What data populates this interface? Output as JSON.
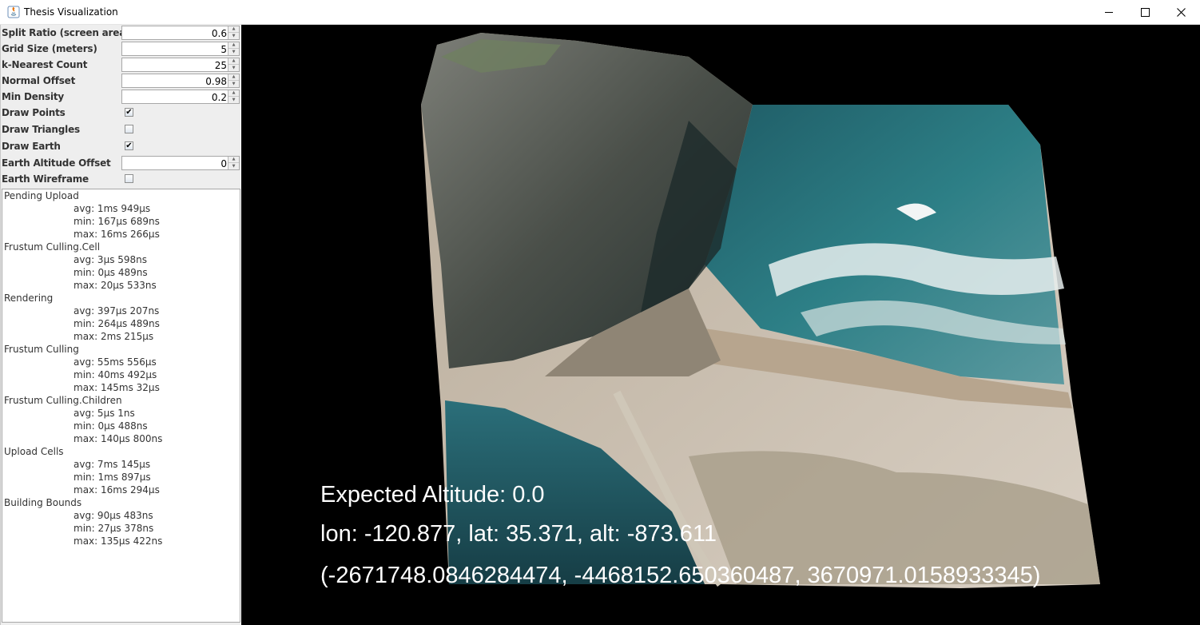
{
  "window": {
    "title": "Thesis Visualization"
  },
  "settings": [
    {
      "label": "Split Ratio (screen area)",
      "type": "spinner",
      "value": "0.6"
    },
    {
      "label": "Grid Size (meters)",
      "type": "spinner",
      "value": "5"
    },
    {
      "label": "k-Nearest Count",
      "type": "spinner",
      "value": "25"
    },
    {
      "label": "Normal Offset",
      "type": "spinner",
      "value": "0.98"
    },
    {
      "label": "Min Density",
      "type": "spinner",
      "value": "0.2"
    },
    {
      "label": "Draw Points",
      "type": "checkbox",
      "checked": true
    },
    {
      "label": "Draw Triangles",
      "type": "checkbox",
      "checked": false
    },
    {
      "label": "Draw Earth",
      "type": "checkbox",
      "checked": true
    },
    {
      "label": "Earth Altitude Offset",
      "type": "spinner",
      "value": "0"
    },
    {
      "label": "Earth Wireframe",
      "type": "checkbox",
      "checked": false
    }
  ],
  "stats": [
    {
      "name": "Pending Upload",
      "avg": "avg: 1ms 949µs",
      "min": "min: 167µs 689ns",
      "max": "max: 16ms 266µs"
    },
    {
      "name": "Frustum Culling.Cell",
      "avg": "avg: 3µs 598ns",
      "min": "min: 0µs 489ns",
      "max": "max: 20µs 533ns"
    },
    {
      "name": "Rendering",
      "avg": "avg: 397µs 207ns",
      "min": "min: 264µs 489ns",
      "max": "max: 2ms 215µs"
    },
    {
      "name": "Frustum Culling",
      "avg": "avg: 55ms 556µs",
      "min": "min: 40ms 492µs",
      "max": "max: 145ms 32µs"
    },
    {
      "name": "Frustum Culling.Children",
      "avg": "avg: 5µs 1ns",
      "min": "min: 0µs 488ns",
      "max": "max: 140µs 800ns"
    },
    {
      "name": "Upload Cells",
      "avg": "avg: 7ms 145µs",
      "min": "min: 1ms 897µs",
      "max": "max: 16ms 294µs"
    },
    {
      "name": "Building Bounds",
      "avg": "avg: 90µs 483ns",
      "min": "min: 27µs 378ns",
      "max": "max: 135µs 422ns"
    }
  ],
  "overlay": {
    "expected_altitude": "Expected Altitude: 0.0",
    "lonlat": "lon: -120.877, lat: 35.371, alt: -873.611",
    "ecef": "(-2671748.0846284474, -4468152.650360487, 3670971.0158933345)"
  },
  "icons": [
    "java-app-icon",
    "minimize-icon",
    "maximize-icon",
    "close-icon",
    "spinner-up-arrow-icon",
    "spinner-down-arrow-icon",
    "checkmark-icon"
  ],
  "colors": {
    "panel_bg": "#eeeeee",
    "viewport_bg": "#000000",
    "overlay_text": "#ffffff"
  }
}
